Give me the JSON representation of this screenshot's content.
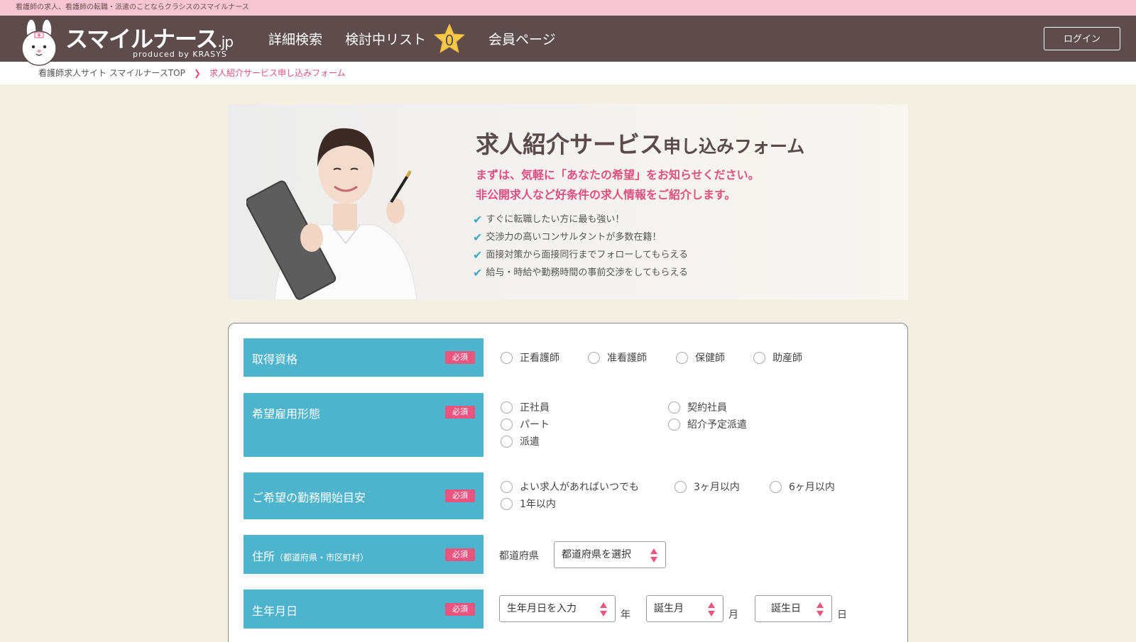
{
  "topbar": {
    "text": "看護師の求人、看護師の転職・派遣のことならクラシスのスマイルナース"
  },
  "header": {
    "logo_main": "スマイルナース",
    "logo_jp": ".jp",
    "logo_sub": "produced by KRASYS",
    "nav": {
      "detail_search": "詳細検索",
      "consider_list": "検討中リスト",
      "consider_count": "0",
      "member_page": "会員ページ"
    },
    "login_label": "ログイン"
  },
  "breadcrumb": {
    "home": "看護師求人サイト スマイルナースTOP",
    "current": "求人紹介サービス申し込みフォーム"
  },
  "hero": {
    "title_main": "求人紹介サービス",
    "title_sub": "申し込みフォーム",
    "lead_1": "まずは、気軽に「あなたの希望」をお知らせください。",
    "lead_2": "非公開求人など好条件の求人情報をご紹介します。",
    "points": [
      "すぐに転職したい方に最も強い！",
      "交渉力の高いコンサルタントが多数在籍！",
      "面接対策から面接同行までフォローしてもらえる",
      "給与・時給や勤務時間の事前交渉をしてもらえる"
    ]
  },
  "form": {
    "required": "必須",
    "qualification": {
      "label": "取得資格",
      "options": [
        "正看護師",
        "准看護師",
        "保健師",
        "助産師"
      ]
    },
    "employment": {
      "label": "希望雇用形態",
      "options": [
        "正社員",
        "契約社員",
        "パート",
        "紹介予定派遣",
        "派遣"
      ]
    },
    "start": {
      "label": "ご希望の勤務開始目安",
      "options": [
        "よい求人があればいつでも",
        "3ヶ月以内",
        "6ヶ月以内",
        "1年以内"
      ]
    },
    "address": {
      "label": "住所",
      "label_sub": "（都道府県・市区町村）",
      "prefecture_label": "都道府県",
      "prefecture_select": "都道府県を選択"
    },
    "birth": {
      "label": "生年月日",
      "year_select": "生年月日を入力",
      "year_unit": "年",
      "month_select": "誕生月",
      "month_unit": "月",
      "day_select": "誕生日",
      "day_unit": "日"
    }
  },
  "colors": {
    "header_bg": "#5e4b4b",
    "topbar_bg": "#f7c6d2",
    "accent_pink": "#e0507e",
    "label_blue": "#4eb4cd",
    "check_blue": "#3fa9c5"
  }
}
